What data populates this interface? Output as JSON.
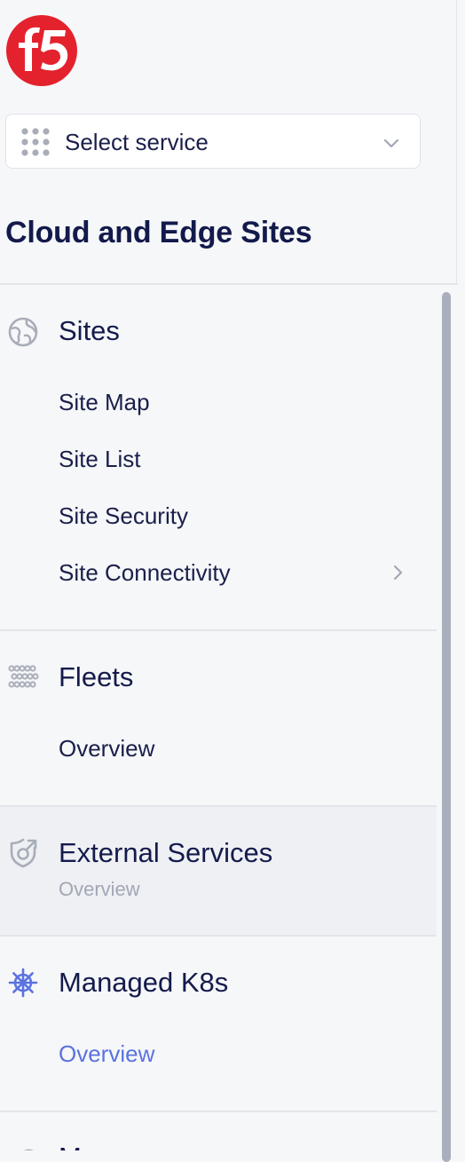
{
  "brand": {
    "logo_text": "f5",
    "logo_color": "#e4222e"
  },
  "service_select": {
    "label": "Select service",
    "icon": "grid-dots-icon",
    "chevron": "chevron-down-icon"
  },
  "page_title": "Cloud and Edge Sites",
  "groups": [
    {
      "label": "Sites",
      "icon": "globe-icon",
      "items": [
        {
          "label": "Site Map"
        },
        {
          "label": "Site List"
        },
        {
          "label": "Site Security"
        },
        {
          "label": "Site Connectivity",
          "has_submenu": true
        }
      ]
    },
    {
      "label": "Fleets",
      "icon": "fleet-icon",
      "items": [
        {
          "label": "Overview"
        }
      ]
    },
    {
      "label": "External Services",
      "icon": "shield-icon",
      "subtitle": "Overview"
    },
    {
      "label": "Managed K8s",
      "icon": "kubernetes-helm-icon",
      "items": [
        {
          "label": "Overview",
          "active": true
        }
      ]
    },
    {
      "label": "M",
      "icon": "partial-icon"
    }
  ],
  "colors": {
    "background": "#f6f7f9",
    "text": "#1a1f4a",
    "accent": "#5a73e0",
    "muted": "#a2a7b4",
    "divider": "#e3e5ea",
    "scrollbar": "#a9afbd"
  }
}
